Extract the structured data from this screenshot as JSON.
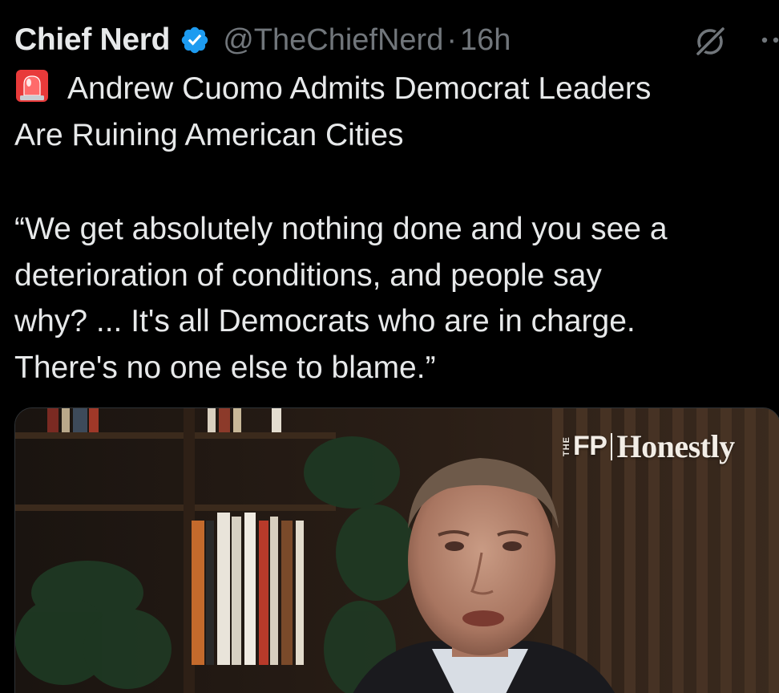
{
  "tweet": {
    "author": {
      "display_name": "Chief Nerd",
      "handle": "@TheChiefNerd",
      "verified": true,
      "verified_color": "#1d9bf0"
    },
    "separator": "·",
    "time": "16h",
    "actions": {
      "grok_icon": "grok-icon",
      "more_icon": "more-icon"
    },
    "text": {
      "emoji": "rotating-light-icon",
      "headline_line1": "Andrew Cuomo Admits Democrat Leaders",
      "headline_line2": "Are Ruining American Cities",
      "quote_line1": "“We get absolutely nothing done and you see a",
      "quote_line2": "deterioration of conditions, and people say",
      "quote_line3": "why? ... It's all Democrats who are in charge.",
      "quote_line4": "There's no one else to blame.”"
    },
    "media": {
      "type": "video-thumbnail",
      "watermark_the": "THE",
      "watermark_fp": "FP",
      "watermark_name": "Honestly"
    }
  },
  "colors": {
    "background": "#000000",
    "text_primary": "#e7e9ea",
    "text_secondary": "#71767b",
    "accent": "#1d9bf0"
  }
}
